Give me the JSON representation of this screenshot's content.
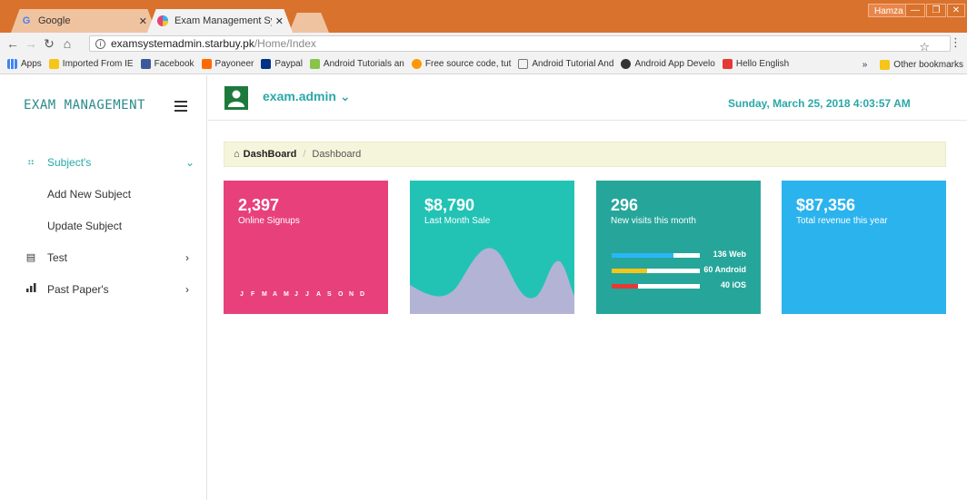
{
  "browser": {
    "tabs": [
      {
        "label": "Google",
        "icon": "google-g-icon"
      },
      {
        "label": "Exam Management Syste",
        "icon": "site-logo-icon"
      }
    ],
    "window_user": "Hamza",
    "url_host": "examsystemadmin.starbuy.pk",
    "url_path": "/Home/Index",
    "bookmarks": [
      "Apps",
      "Imported From IE",
      "Facebook",
      "Payoneer",
      "Paypal",
      "Android Tutorials an",
      "Free source code, tut",
      "Android Tutorial And",
      "Android App Develo",
      "Hello English"
    ],
    "bookmarks_overflow": "»",
    "other_bookmarks": "Other bookmarks"
  },
  "app": {
    "brand": "EXAM MANAGEMENT",
    "user": "exam.admin ⌄",
    "datetime": "Sunday, March 25, 2018 4:03:57 AM"
  },
  "sidebar": {
    "items": [
      {
        "label": "Subject's",
        "icon": "grid-icon",
        "active": true,
        "children": [
          {
            "label": "Add New Subject"
          },
          {
            "label": "Update Subject"
          }
        ]
      },
      {
        "label": "Test",
        "icon": "document-icon"
      },
      {
        "label": "Past Paper's",
        "icon": "bar-chart-icon"
      }
    ]
  },
  "breadcrumb": {
    "home": "DashBoard",
    "current": "Dashboard"
  },
  "cards": [
    {
      "value": "2,397",
      "label": "Online Signups",
      "color": "#e8407a",
      "months": [
        "J",
        "F",
        "M",
        "A",
        "M",
        "J",
        "J",
        "A",
        "S",
        "O",
        "N",
        "D"
      ]
    },
    {
      "value": "$8,790",
      "label": "Last Month Sale",
      "color": "#22c3b5"
    },
    {
      "value": "296",
      "label": "New visits this month",
      "color": "#26a69a",
      "bars": [
        {
          "label": "136 Web",
          "fraction": 0.7,
          "color": "#29b6f6"
        },
        {
          "label": "60 Android",
          "fraction": 0.4,
          "color": "#f5c518"
        },
        {
          "label": "40 iOS",
          "fraction": 0.3,
          "color": "#e53935"
        }
      ]
    },
    {
      "value": "$87,356",
      "label": "Total revenue this year",
      "color": "#2bb3ee"
    }
  ]
}
